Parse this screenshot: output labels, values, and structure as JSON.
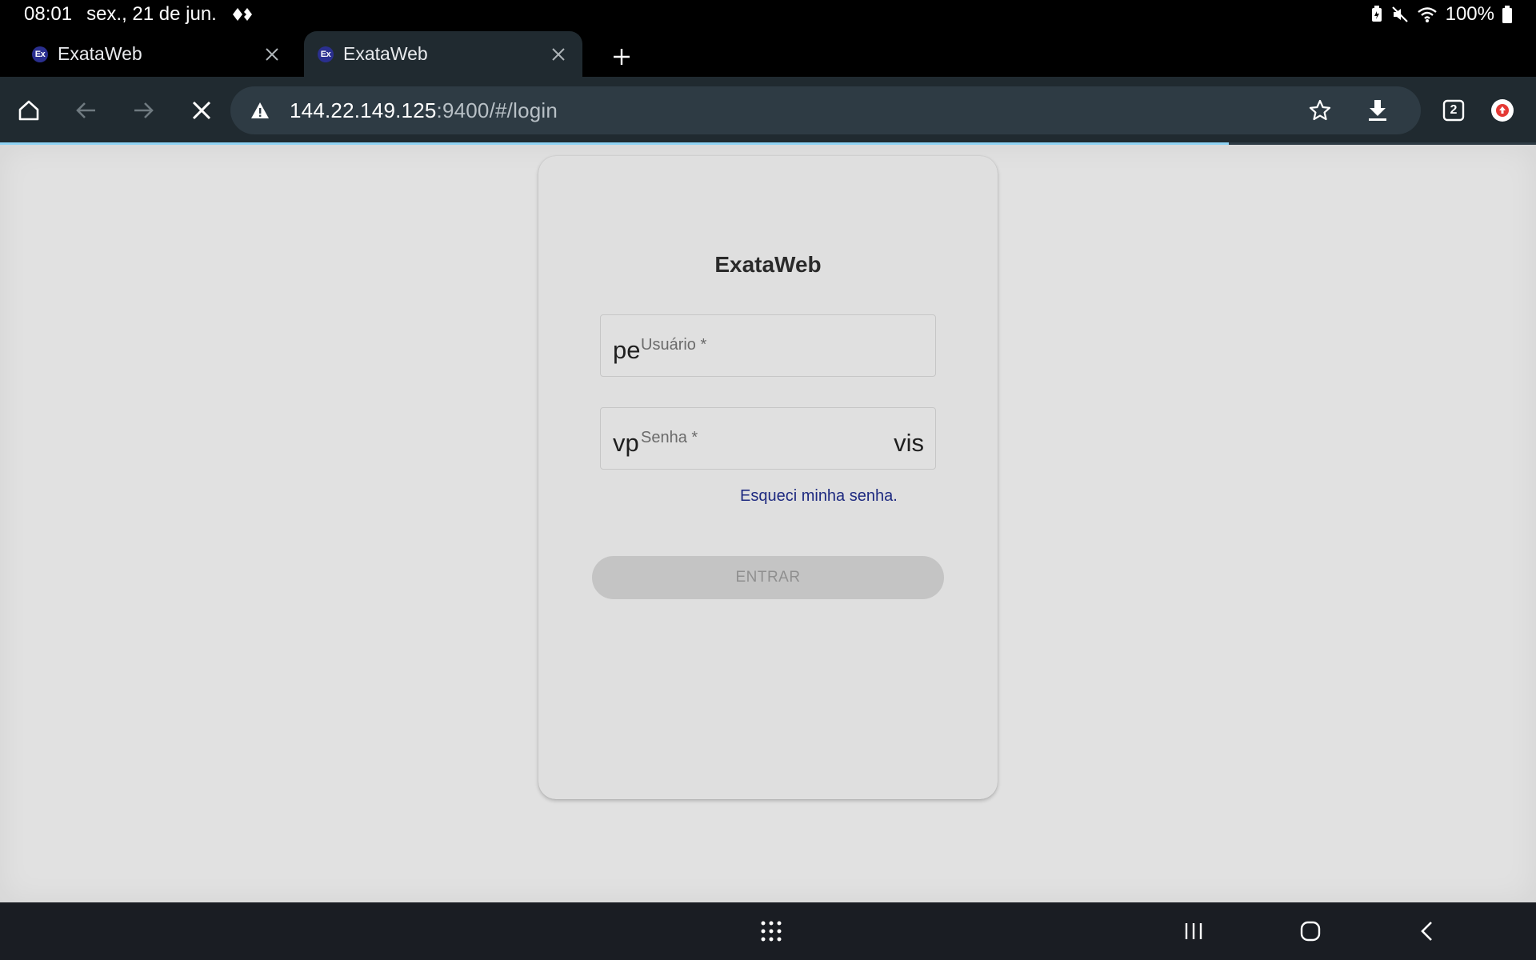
{
  "status_bar": {
    "time": "08:01",
    "date": "sex., 21 de jun.",
    "battery": "100%",
    "icons": [
      "data-transfer-icon",
      "battery-saver-icon",
      "mute-icon",
      "wifi-icon",
      "battery-icon"
    ]
  },
  "tabs": [
    {
      "title": "ExataWeb",
      "favicon": "Ex",
      "active": false
    },
    {
      "title": "ExataWeb",
      "favicon": "Ex",
      "active": true
    }
  ],
  "toolbar": {
    "url_host": "144.22.149.125",
    "url_path": ":9400/#/login",
    "tab_count": "2",
    "load_progress": 0.8
  },
  "login": {
    "title": "ExataWeb",
    "username": {
      "value": "pe",
      "label": "Usuário *"
    },
    "password": {
      "value": "vp",
      "label": "Senha *",
      "suffix": "vis"
    },
    "forgot_link": "Esqueci minha senha.",
    "submit_label": "ENTRAR"
  },
  "colors": {
    "accent_link": "#1e2a80",
    "progress": "#8fd3f4",
    "toolbar_bg": "#202a30"
  }
}
